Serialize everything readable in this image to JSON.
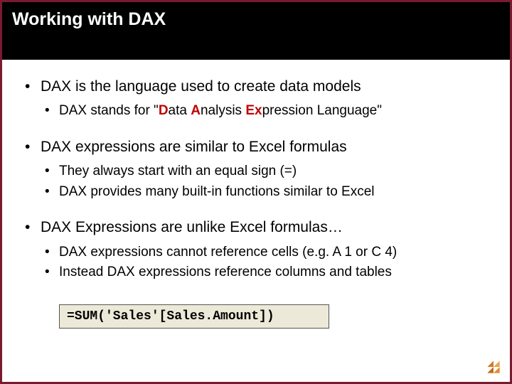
{
  "title": "Working with DAX",
  "bullets": [
    {
      "text": "DAX is the language used to create data models",
      "sub": [
        {
          "pre": "DAX stands for \"",
          "hl_d": "D",
          "mid1": "ata ",
          "hl_a": "A",
          "mid2": "nalysis ",
          "hl_ex": "Ex",
          "post": "pression Language\""
        }
      ]
    },
    {
      "text": "DAX expressions are similar to Excel formulas",
      "sub": [
        {
          "plain": "They always start with an equal sign (=)"
        },
        {
          "plain": "DAX provides many built-in functions similar to Excel"
        }
      ]
    },
    {
      "text": "DAX Expressions are unlike Excel formulas…",
      "sub": [
        {
          "plain": "DAX expressions cannot reference cells (e.g. A 1 or C 4)"
        },
        {
          "plain": "Instead DAX expressions reference columns and tables"
        }
      ]
    }
  ],
  "code": "=SUM('Sales'[Sales.Amount])"
}
